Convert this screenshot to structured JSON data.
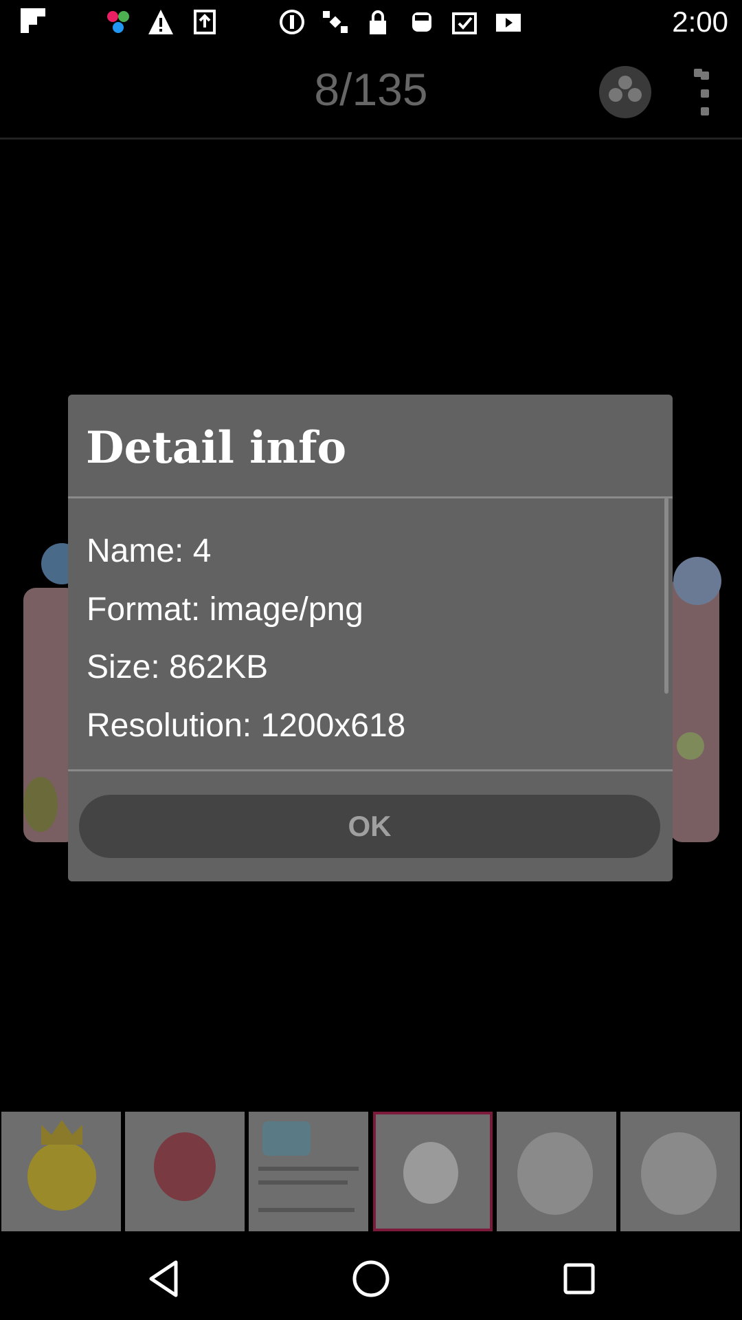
{
  "status_bar": {
    "time": "2:00",
    "icons": [
      "flipboard-icon",
      "colorful-app-icon",
      "warning-icon",
      "upload-icon",
      "blocked-icon",
      "satellite-icon",
      "lock-icon",
      "gamepad-icon",
      "inbox-icon",
      "video-icon"
    ]
  },
  "app_bar": {
    "counter": "8/135",
    "share_icon": "share-icon",
    "menu_icon": "more-vert-icon"
  },
  "dialog": {
    "title": "Detail info",
    "name": "Name: 4",
    "format": "Format: image/png",
    "size": "Size: 862KB",
    "resolution": "Resolution: 1200x618",
    "ok_label": "OK"
  },
  "thumbnails": [
    {
      "subject": "crowned-smiley",
      "selected": false
    },
    {
      "subject": "red-rose",
      "selected": false
    },
    {
      "subject": "baby-bath-poster",
      "selected": false
    },
    {
      "subject": "baby-massage-1",
      "selected": true
    },
    {
      "subject": "baby-massage-2",
      "selected": false
    },
    {
      "subject": "baby-massage-3",
      "selected": false
    }
  ],
  "nav_bar": {
    "back_icon": "back-triangle-icon",
    "home_icon": "home-circle-icon",
    "recents_icon": "recents-square-icon"
  },
  "colors": {
    "dialog_bg": "#626262",
    "button_bg": "#444444",
    "selected_thumb_border": "#7b1a3a",
    "counter_text": "#666666"
  }
}
